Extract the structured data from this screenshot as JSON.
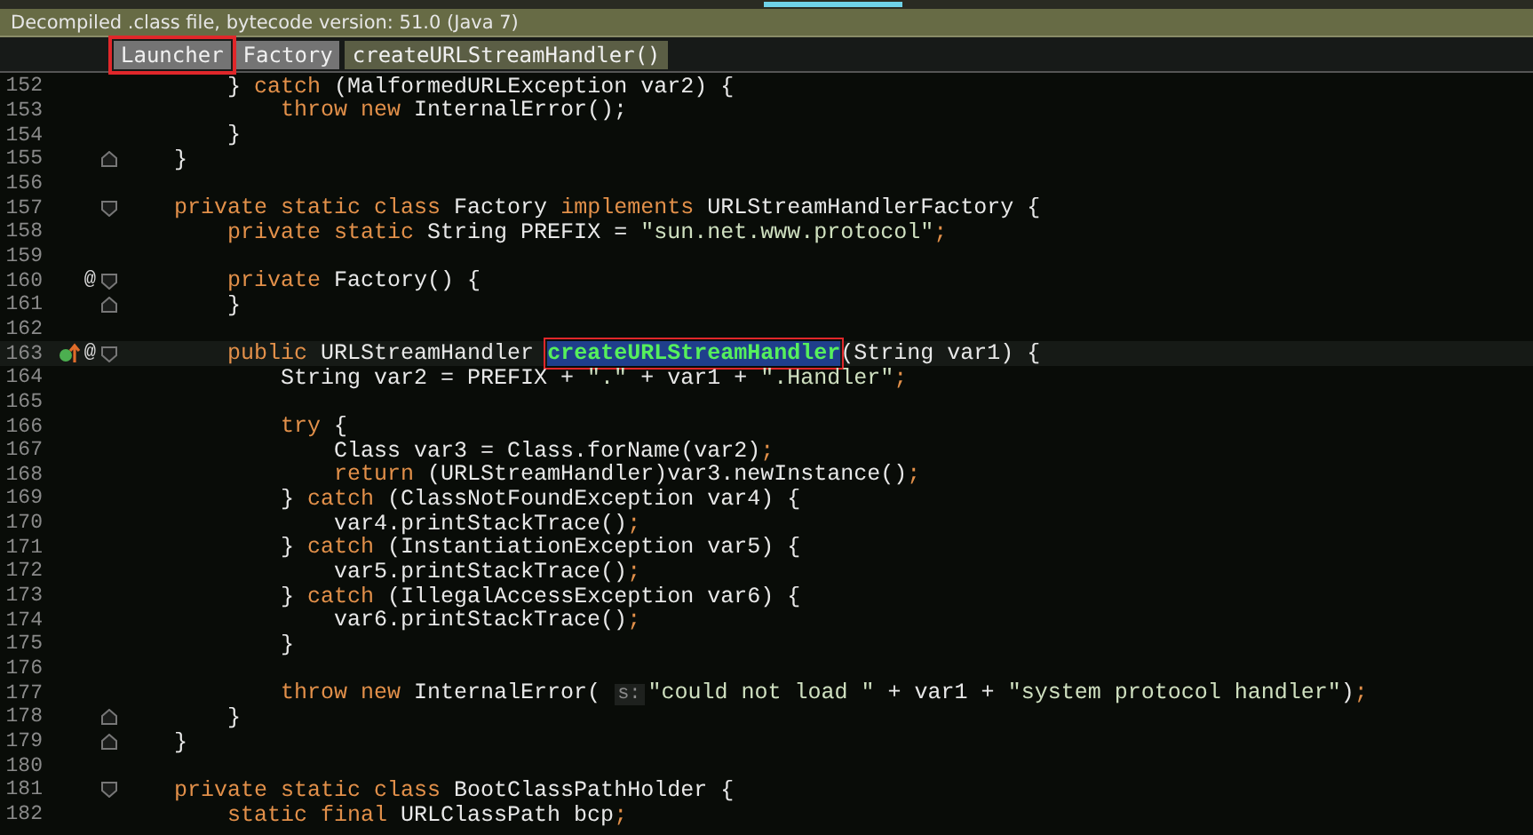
{
  "banner": {
    "text": "Decompiled .class file, bytecode version: 51.0 (Java 7)"
  },
  "breadcrumbs": [
    {
      "label": "Launcher",
      "selected": false,
      "boxed": true
    },
    {
      "label": "Factory",
      "selected": false,
      "boxed": false
    },
    {
      "label": "createURLStreamHandler()",
      "selected": true,
      "boxed": false
    }
  ],
  "lines": [
    {
      "number": "152",
      "current": false,
      "tokens": [
        {
          "kind": "plain",
          "text": "        } "
        },
        {
          "kind": "kw",
          "text": "catch"
        },
        {
          "kind": "plain",
          "text": " (MalformedURLException var2) {"
        }
      ]
    },
    {
      "number": "153",
      "current": false,
      "tokens": [
        {
          "kind": "kw",
          "text": "            throw new"
        },
        {
          "kind": "plain",
          "text": " InternalError();"
        }
      ]
    },
    {
      "number": "154",
      "current": false,
      "tokens": [
        {
          "kind": "plain",
          "text": "        }"
        }
      ]
    },
    {
      "number": "155",
      "current": false,
      "fold": {
        "kind": "end"
      },
      "tokens": [
        {
          "kind": "plain",
          "text": "    }"
        }
      ]
    },
    {
      "number": "156",
      "current": false
    },
    {
      "number": "157",
      "current": false,
      "fold": {
        "kind": "start"
      },
      "tokens": [
        {
          "kind": "kw",
          "text": "    private static class"
        },
        {
          "kind": "plain",
          "text": " Factory "
        },
        {
          "kind": "kw",
          "text": "implements"
        },
        {
          "kind": "plain",
          "text": " URLStreamHandlerFactory {"
        }
      ]
    },
    {
      "number": "158",
      "current": false,
      "tokens": [
        {
          "kind": "kw",
          "text": "        private static"
        },
        {
          "kind": "plain",
          "text": " String PREFIX = "
        },
        {
          "kind": "str",
          "text": "\"sun.net.www.protocol\""
        },
        {
          "kind": "kw",
          "text": ";"
        }
      ]
    },
    {
      "number": "159",
      "current": false
    },
    {
      "number": "160",
      "current": false,
      "fold": {
        "kind": "start"
      },
      "marks": [
        {
          "kind": "override",
          "text": "@"
        }
      ],
      "tokens": [
        {
          "kind": "kw",
          "text": "        private"
        },
        {
          "kind": "plain",
          "text": " Factory() {"
        }
      ]
    },
    {
      "number": "161",
      "current": false,
      "fold": {
        "kind": "end"
      },
      "tokens": [
        {
          "kind": "plain",
          "text": "        }"
        }
      ]
    },
    {
      "number": "162",
      "current": false
    },
    {
      "number": "163",
      "current": true,
      "fold": {
        "kind": "start"
      },
      "marks": [
        {
          "kind": "implements"
        },
        {
          "kind": "override",
          "text": "@"
        },
        {
          "kind": "bulb"
        }
      ],
      "tokens": [
        {
          "kind": "kw",
          "text": "        public"
        },
        {
          "kind": "plain",
          "text": " URLStreamHandler "
        },
        {
          "kind": "match",
          "text": "createURLStreamHandler"
        },
        {
          "kind": "plain",
          "text": "(String var1) {"
        }
      ]
    },
    {
      "number": "164",
      "current": false,
      "tokens": [
        {
          "kind": "plain",
          "text": "            String var2 = PREFIX + "
        },
        {
          "kind": "str",
          "text": "\".\""
        },
        {
          "kind": "plain",
          "text": " + var1 + "
        },
        {
          "kind": "str",
          "text": "\".Handler\""
        },
        {
          "kind": "kw",
          "text": ";"
        }
      ]
    },
    {
      "number": "165",
      "current": false
    },
    {
      "number": "166",
      "current": false,
      "tokens": [
        {
          "kind": "kw",
          "text": "            try"
        },
        {
          "kind": "plain",
          "text": " {"
        }
      ]
    },
    {
      "number": "167",
      "current": false,
      "tokens": [
        {
          "kind": "plain",
          "text": "                Class var3 = Class.forName(var2)"
        },
        {
          "kind": "kw",
          "text": ";"
        }
      ]
    },
    {
      "number": "168",
      "current": false,
      "tokens": [
        {
          "kind": "kw",
          "text": "                return"
        },
        {
          "kind": "plain",
          "text": " (URLStreamHandler)var3.newInstance()"
        },
        {
          "kind": "kw",
          "text": ";"
        }
      ]
    },
    {
      "number": "169",
      "current": false,
      "tokens": [
        {
          "kind": "plain",
          "text": "            } "
        },
        {
          "kind": "kw",
          "text": "catch"
        },
        {
          "kind": "plain",
          "text": " (ClassNotFoundException var4) {"
        }
      ]
    },
    {
      "number": "170",
      "current": false,
      "tokens": [
        {
          "kind": "plain",
          "text": "                var4.printStackTrace()"
        },
        {
          "kind": "kw",
          "text": ";"
        }
      ]
    },
    {
      "number": "171",
      "current": false,
      "tokens": [
        {
          "kind": "plain",
          "text": "            } "
        },
        {
          "kind": "kw",
          "text": "catch"
        },
        {
          "kind": "plain",
          "text": " (InstantiationException var5) {"
        }
      ]
    },
    {
      "number": "172",
      "current": false,
      "tokens": [
        {
          "kind": "plain",
          "text": "                var5.printStackTrace()"
        },
        {
          "kind": "kw",
          "text": ";"
        }
      ]
    },
    {
      "number": "173",
      "current": false,
      "tokens": [
        {
          "kind": "plain",
          "text": "            } "
        },
        {
          "kind": "kw",
          "text": "catch"
        },
        {
          "kind": "plain",
          "text": " (IllegalAccessException var6) {"
        }
      ]
    },
    {
      "number": "174",
      "current": false,
      "tokens": [
        {
          "kind": "plain",
          "text": "                var6.printStackTrace()"
        },
        {
          "kind": "kw",
          "text": ";"
        }
      ]
    },
    {
      "number": "175",
      "current": false,
      "tokens": [
        {
          "kind": "plain",
          "text": "            }"
        }
      ]
    },
    {
      "number": "176",
      "current": false
    },
    {
      "number": "177",
      "current": false,
      "tokens": [
        {
          "kind": "kw",
          "text": "            throw new"
        },
        {
          "kind": "plain",
          "text": " InternalError( "
        },
        {
          "kind": "hint",
          "text": "s:"
        },
        {
          "kind": "str",
          "text": "\"could not load \""
        },
        {
          "kind": "plain",
          "text": " + var1 + "
        },
        {
          "kind": "str",
          "text": "\"system protocol handler\""
        },
        {
          "kind": "plain",
          "text": ")"
        },
        {
          "kind": "kw",
          "text": ";"
        }
      ]
    },
    {
      "number": "178",
      "current": false,
      "fold": {
        "kind": "end"
      },
      "tokens": [
        {
          "kind": "plain",
          "text": "        }"
        }
      ]
    },
    {
      "number": "179",
      "current": false,
      "fold": {
        "kind": "end"
      },
      "tokens": [
        {
          "kind": "plain",
          "text": "    }"
        }
      ]
    },
    {
      "number": "180",
      "current": false
    },
    {
      "number": "181",
      "current": false,
      "fold": {
        "kind": "start"
      },
      "tokens": [
        {
          "kind": "kw",
          "text": "    private static class"
        },
        {
          "kind": "plain",
          "text": " BootClassPathHolder {"
        }
      ]
    },
    {
      "number": "182",
      "current": false,
      "tokens": [
        {
          "kind": "kw",
          "text": "        static final"
        },
        {
          "kind": "plain",
          "text": " URLClassPath bcp"
        },
        {
          "kind": "kw",
          "text": ";"
        }
      ]
    }
  ]
}
